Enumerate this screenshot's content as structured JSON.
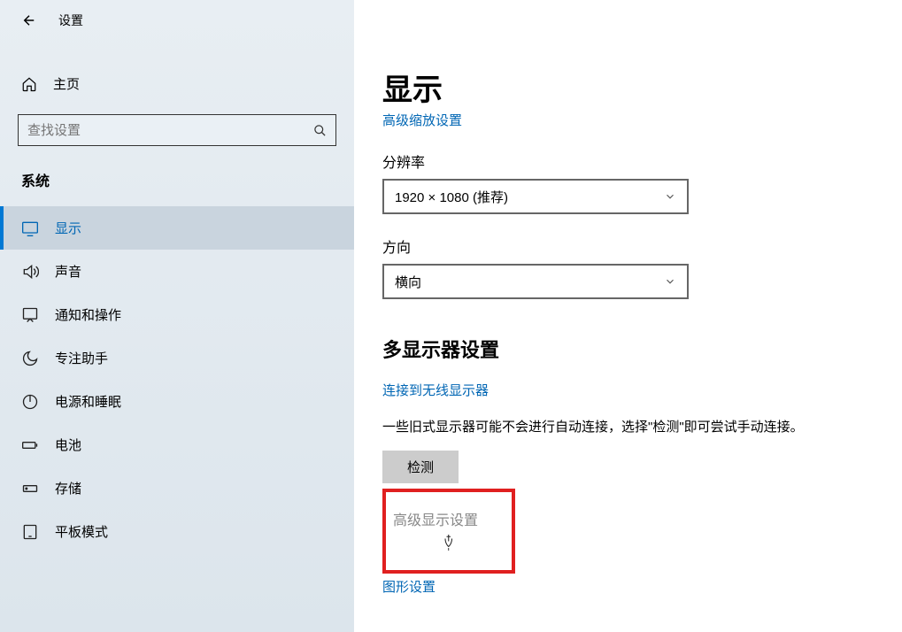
{
  "titlebar": {
    "title": "设置"
  },
  "sidebar": {
    "home": "主页",
    "search_placeholder": "查找设置",
    "category": "系统",
    "items": [
      {
        "label": "显示",
        "icon": "display"
      },
      {
        "label": "声音",
        "icon": "sound"
      },
      {
        "label": "通知和操作",
        "icon": "notification"
      },
      {
        "label": "专注助手",
        "icon": "focus"
      },
      {
        "label": "电源和睡眠",
        "icon": "power"
      },
      {
        "label": "电池",
        "icon": "battery"
      },
      {
        "label": "存储",
        "icon": "storage"
      },
      {
        "label": "平板模式",
        "icon": "tablet"
      }
    ]
  },
  "main": {
    "heading": "显示",
    "top_link": "高级缩放设置",
    "resolution": {
      "label": "分辨率",
      "value": "1920 × 1080 (推荐)"
    },
    "orientation": {
      "label": "方向",
      "value": "横向"
    },
    "multi_heading": "多显示器设置",
    "wireless_link": "连接到无线显示器",
    "detect_desc": "一些旧式显示器可能不会进行自动连接，选择\"检测\"即可尝试手动连接。",
    "detect_btn": "检测",
    "advanced_link": "高级显示设置",
    "graphics_link": "图形设置"
  }
}
